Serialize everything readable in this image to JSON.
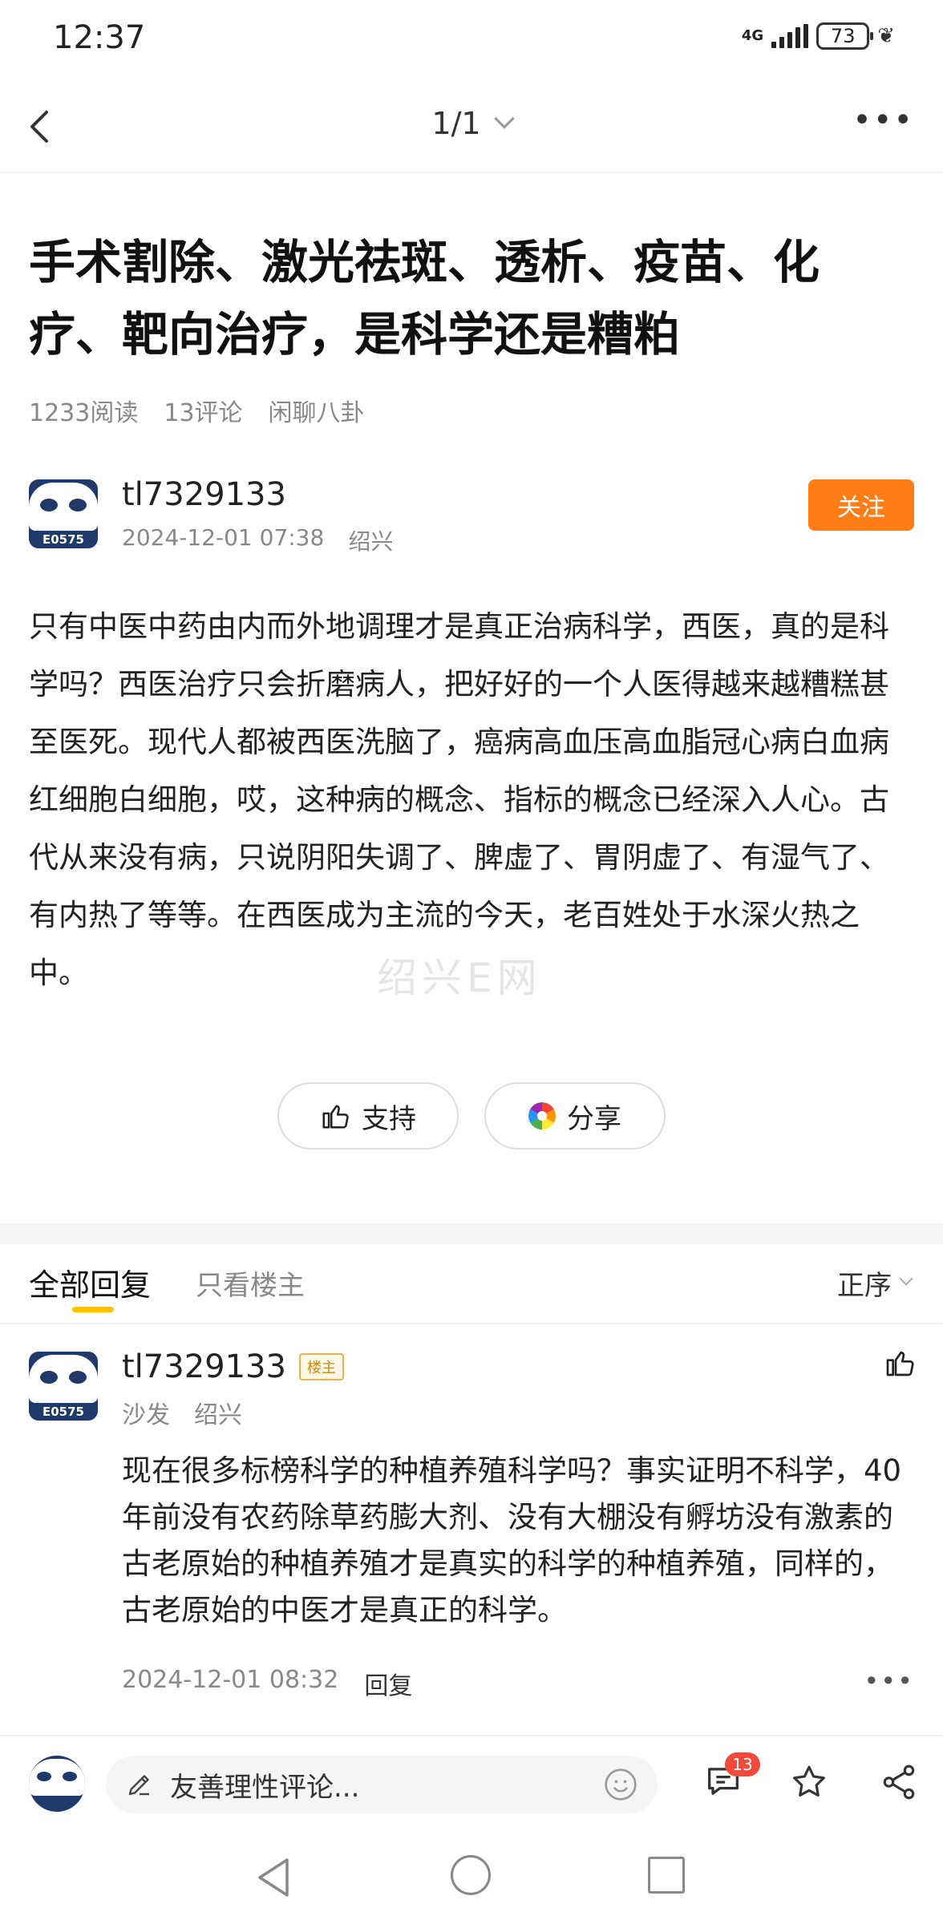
{
  "status_bar": {
    "time": "12:37",
    "network": "4G",
    "battery": "73"
  },
  "nav": {
    "page_indicator": "1/1"
  },
  "post": {
    "title": "手术割除、激光祛斑、透析、疫苗、化疗、靶向治疗，是科学还是糟粕",
    "reads": "1233阅读",
    "comments": "13评论",
    "category": "闲聊八卦",
    "author": {
      "name": "tl7329133",
      "date": "2024-12-01 07:38",
      "location": "绍兴",
      "avatar_text": "E0575"
    },
    "follow_label": "关注",
    "body": "只有中医中药由内而外地调理才是真正治病科学，西医，真的是科学吗？西医治疗只会折磨病人，把好好的一个人医得越来越糟糕甚至医死。现代人都被西医洗脑了，癌病高血压高血脂冠心病白血病红细胞白细胞，哎，这种病的概念、指标的概念已经深入人心。古代从来没有病，只说阴阳失调了、脾虚了、胃阴虚了、有湿气了、有内热了等等。在西医成为主流的今天，老百姓处于水深火热之中。",
    "watermark": "绍兴E网",
    "like_label": "支持",
    "share_label": "分享"
  },
  "comments_section": {
    "tabs": [
      "全部回复",
      "只看楼主"
    ],
    "sort_label": "正序",
    "items": [
      {
        "name": "tl7329133",
        "badge": "楼主",
        "floor": "沙发",
        "location": "绍兴",
        "avatar_text": "E0575",
        "text": "现在很多标榜科学的种植养殖科学吗？事实证明不科学，40年前没有农药除草药膨大剂、没有大棚没有孵坊没有激素的古老原始的种植养殖才是真实的科学的种植养殖，同样的，古老原始的中医才是真正的科学。",
        "date": "2024-12-01 08:32",
        "reply_label": "回复"
      }
    ]
  },
  "bottom_bar": {
    "input_placeholder": "友善理性评论...",
    "comment_count": "13"
  },
  "icons": [
    "back-icon",
    "chevron-down-icon",
    "more-icon",
    "thumbs-up-icon",
    "share-icon",
    "pen-icon",
    "emoji-icon",
    "comment-icon",
    "star-icon",
    "share-nodes-icon"
  ],
  "colors": {
    "accent": "#ff7d14",
    "tab_underline": "#ffc000",
    "badge_red": "#ef4a3c"
  }
}
